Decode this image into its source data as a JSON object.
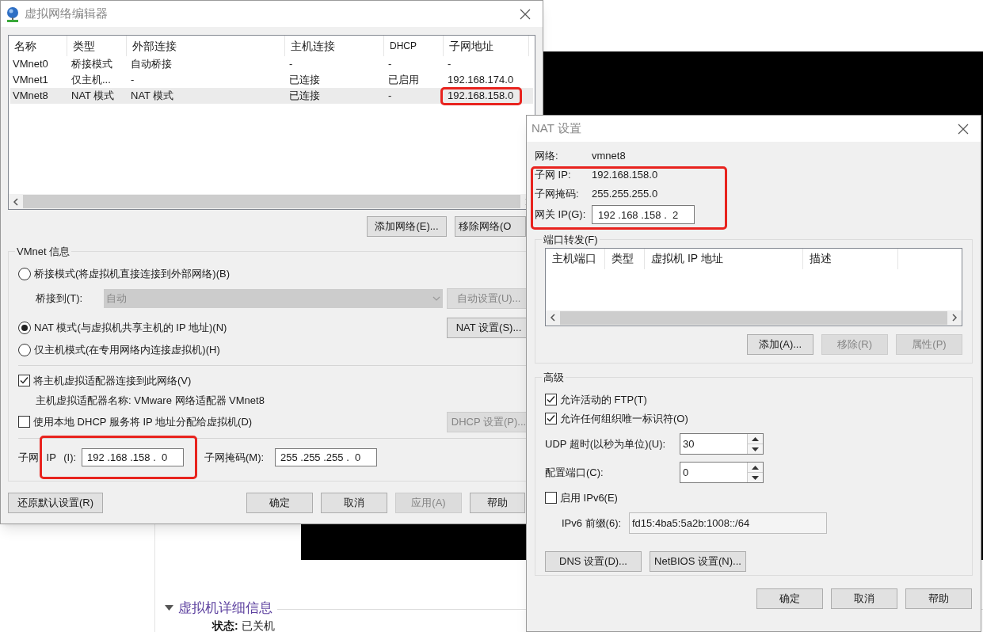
{
  "editor": {
    "title": "虚拟网络编辑器",
    "columns": [
      "名称",
      "类型",
      "外部连接",
      "主机连接",
      "DHCP",
      "子网地址"
    ],
    "rows": [
      {
        "cells": [
          "VMnet0",
          "桥接模式",
          "自动桥接",
          "-",
          "-",
          "-"
        ],
        "selected": false,
        "highlighted": false
      },
      {
        "cells": [
          "VMnet1",
          "仅主机...",
          "-",
          "已连接",
          "已启用",
          "192.168.174.0"
        ],
        "selected": false,
        "highlighted": false
      },
      {
        "cells": [
          "VMnet8",
          "NAT 模式",
          "NAT 模式",
          "已连接",
          "-",
          "192.168.158.0"
        ],
        "selected": true,
        "highlighted": true
      }
    ],
    "list_buttons": [
      {
        "label": "添加网络(E)...",
        "disabled": false
      },
      {
        "label": "移除网络(O",
        "disabled": false
      }
    ],
    "group_title": "VMnet 信息",
    "modes": [
      {
        "label": "桥接模式(将虚拟机直接连接到外部网络)(B)",
        "selected": false
      },
      {
        "label": "NAT 模式(与虚拟机共享主机的 IP 地址)(N)",
        "selected": true
      },
      {
        "label": "仅主机模式(在专用网络内连接虚拟机)(H)",
        "selected": false
      }
    ],
    "bridge_to": {
      "label": "桥接到(T):",
      "value": "自动",
      "disabled": true
    },
    "auto_settings_button": {
      "label": "自动设置(U)...",
      "disabled": true
    },
    "nat_settings_button": {
      "label": "NAT 设置(S)...",
      "disabled": false
    },
    "connect_adapter": {
      "label": "将主机虚拟适配器连接到此网络(V)",
      "checked": true
    },
    "adapter_name": "主机虚拟适配器名称: VMware 网络适配器 VMnet8",
    "use_dhcp": {
      "label": "使用本地 DHCP 服务将 IP 地址分配给虚拟机(D)",
      "checked": false
    },
    "dhcp_settings_button": {
      "label": "DHCP 设置(P)...",
      "disabled": true
    },
    "subnet_ip": {
      "label": "子网 IP (I):",
      "value": "192 .168 .158 .  0",
      "highlighted": true
    },
    "subnet_mask": {
      "label": "子网掩码(M):",
      "value": "255 .255 .255 .  0"
    },
    "restore_button": {
      "label": "还原默认设置(R)",
      "disabled": false
    },
    "dialog_buttons": [
      {
        "label": "确定",
        "disabled": false
      },
      {
        "label": "取消",
        "disabled": false
      },
      {
        "label": "应用(A)",
        "disabled": true
      },
      {
        "label": "帮助",
        "disabled": false
      }
    ]
  },
  "nat": {
    "title": "NAT 设置",
    "network": {
      "label": "网络:",
      "value": "vmnet8"
    },
    "subnet_ip": {
      "label": "子网 IP:",
      "value": "192.168.158.0"
    },
    "subnet_mask": {
      "label": "子网掩码:",
      "value": "255.255.255.0"
    },
    "gateway": {
      "label": "网关 IP(G):",
      "value": "192 .168 .158 .  2"
    },
    "info_highlighted": true,
    "port_forwarding": {
      "title": "端口转发(F)",
      "columns": [
        "主机端口",
        "类型",
        "虚拟机 IP 地址",
        "描述"
      ],
      "buttons": [
        {
          "label": "添加(A)...",
          "disabled": false
        },
        {
          "label": "移除(R)",
          "disabled": true
        },
        {
          "label": "属性(P)",
          "disabled": true
        }
      ]
    },
    "advanced": {
      "title": "高级",
      "allow_ftp": {
        "label": "允许活动的 FTP(T)",
        "checked": true
      },
      "allow_oui": {
        "label": "允许任何组织唯一标识符(O)",
        "checked": true
      },
      "udp_timeout": {
        "label": "UDP 超时(以秒为单位)(U):",
        "value": "30"
      },
      "config_port": {
        "label": "配置端口(C):",
        "value": "0"
      },
      "enable_ipv6": {
        "label": "启用 IPv6(E)",
        "checked": false
      },
      "ipv6_prefix": {
        "label": "IPv6 前缀(6):",
        "value": "fd15:4ba5:5a2b:1008::/64",
        "disabled": true
      },
      "buttons": [
        {
          "label": "DNS 设置(D)...",
          "disabled": false
        },
        {
          "label": "NetBIOS 设置(N)...",
          "disabled": false
        }
      ]
    },
    "dialog_buttons": [
      {
        "label": "确定",
        "disabled": false
      },
      {
        "label": "取消",
        "disabled": false
      },
      {
        "label": "帮助",
        "disabled": false
      }
    ]
  },
  "background": {
    "section_title": "虚拟机详细信息",
    "expanded": true,
    "status_label": "状态:",
    "status_value": "已关机"
  }
}
